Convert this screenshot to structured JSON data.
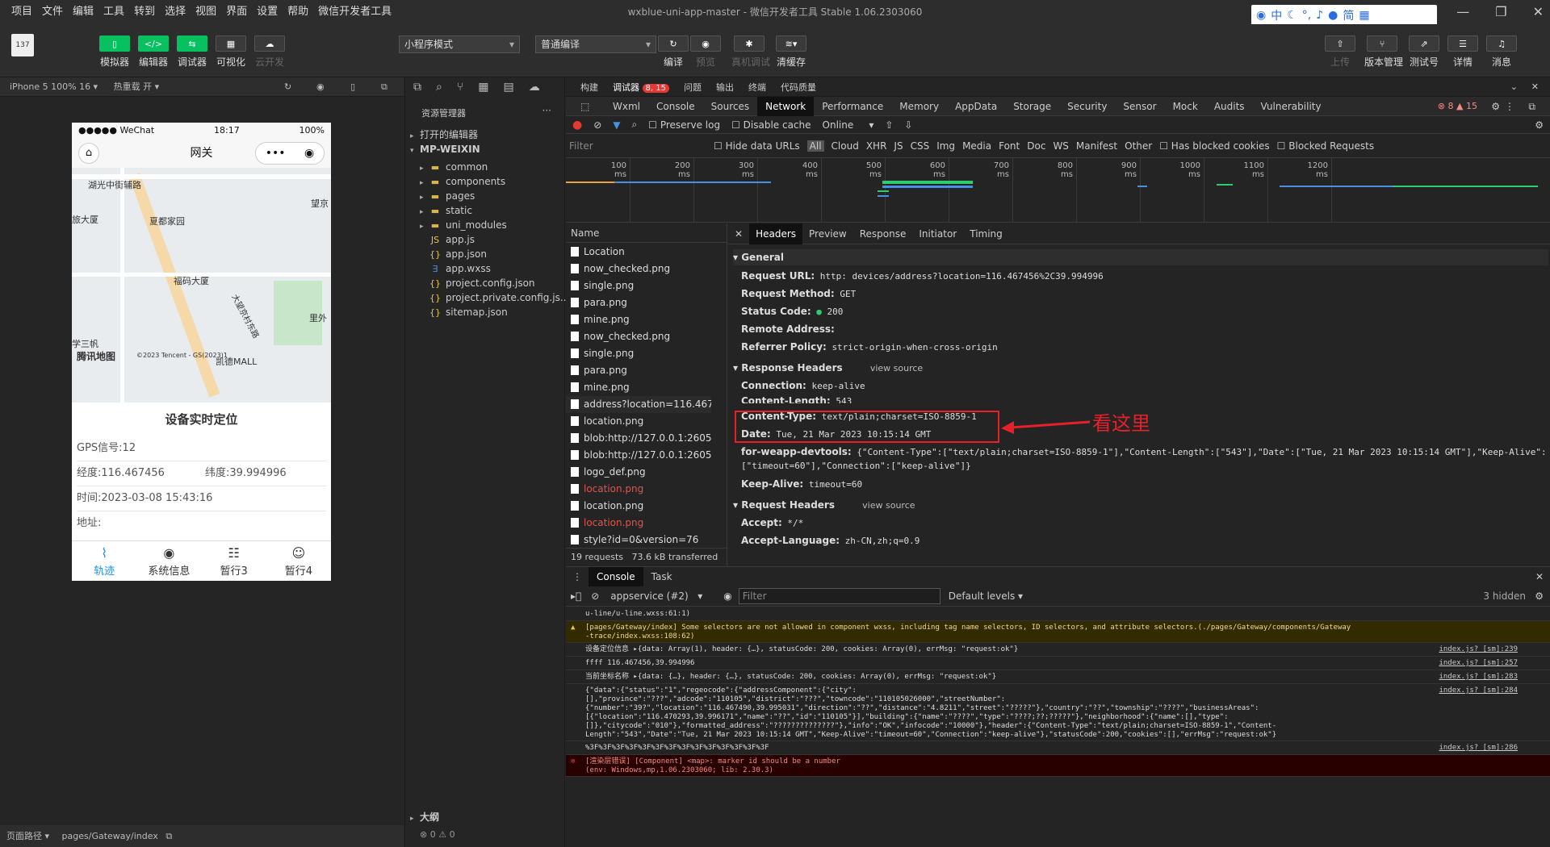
{
  "titlebar": {
    "menu": [
      "项目",
      "文件",
      "编辑",
      "工具",
      "转到",
      "选择",
      "视图",
      "界面",
      "设置",
      "帮助",
      "微信开发者工具"
    ],
    "title": "wxblue-uni-app-master - 微信开发者工具 Stable 1.06.2303060",
    "ime": [
      "中",
      "简"
    ]
  },
  "toolbar": {
    "avatar": "137",
    "buttons": [
      "模拟器",
      "编辑器",
      "调试器",
      "可视化",
      "云开发"
    ],
    "mode_select": "小程序模式",
    "compile_select": "普通编译",
    "mid_buttons": [
      "编译",
      "预览",
      "真机调试",
      "清缓存"
    ],
    "right_buttons": [
      "上传",
      "版本管理",
      "测试号",
      "详情",
      "消息"
    ]
  },
  "sim": {
    "device": "iPhone 5 100% 16 ▾",
    "hotreload": "热重载 开 ▾",
    "footer_path_label": "页面路径 ▾",
    "footer_path": "pages/Gateway/index"
  },
  "phone": {
    "carrier": "●●●●● WeChat",
    "time": "18:17",
    "battery": "100%",
    "nav_title": "网关",
    "map_labels": [
      "湖光中街辅路",
      "望京",
      "旅大厦",
      "夏都家园",
      "福码大厦",
      "里外",
      "学三帆",
      "腾讯地图",
      "©2023 Tencent - GS(2023)1",
      "凯德MALL",
      "大望京村东路"
    ],
    "section_title": "设备实时定位",
    "gps": "GPS信号:12",
    "lng": "经度:116.467456",
    "lat": "纬度:39.994996",
    "time_row": "时间:2023-03-08 15:43:16",
    "addr": "地址:",
    "tabs": [
      "轨迹",
      "系统信息",
      "暂行3",
      "暂行4"
    ]
  },
  "explorer": {
    "title": "资源管理器",
    "open_editors": "打开的编辑器",
    "root": "MP-WEIXIN",
    "items": [
      {
        "name": "common",
        "type": "folder"
      },
      {
        "name": "components",
        "type": "folder"
      },
      {
        "name": "pages",
        "type": "folder"
      },
      {
        "name": "static",
        "type": "folder"
      },
      {
        "name": "uni_modules",
        "type": "folder"
      },
      {
        "name": "app.js",
        "type": "js"
      },
      {
        "name": "app.json",
        "type": "json"
      },
      {
        "name": "app.wxss",
        "type": "wxss"
      },
      {
        "name": "project.config.json",
        "type": "json"
      },
      {
        "name": "project.private.config.js...",
        "type": "json"
      },
      {
        "name": "sitemap.json",
        "type": "json"
      }
    ],
    "outline": "大纲",
    "status": "⊗ 0 ⚠ 0"
  },
  "devtools": {
    "top_tabs": [
      "构建",
      "调试器",
      "问题",
      "输出",
      "终端",
      "代码质量"
    ],
    "badge": "8, 15",
    "panels": [
      "Wxml",
      "Console",
      "Sources",
      "Network",
      "Performance",
      "Memory",
      "AppData",
      "Storage",
      "Security",
      "Sensor",
      "Mock",
      "Audits",
      "Vulnerability"
    ],
    "counts": "⊗ 8 ▲ 15",
    "net_toolbar": {
      "preserve": "Preserve log",
      "disable": "Disable cache",
      "online": "Online"
    },
    "filter": {
      "placeholder": "Filter",
      "hide": "Hide data URLs",
      "types": [
        "All",
        "Cloud",
        "XHR",
        "JS",
        "CSS",
        "Img",
        "Media",
        "Font",
        "Doc",
        "WS",
        "Manifest",
        "Other"
      ],
      "blocked_cookies": "Has blocked cookies",
      "blocked_requests": "Blocked Requests"
    },
    "ticks": [
      "100 ms",
      "200 ms",
      "300 ms",
      "400 ms",
      "500 ms",
      "600 ms",
      "700 ms",
      "800 ms",
      "900 ms",
      "1000 ms",
      "1100 ms",
      "1200 ms"
    ],
    "name_header": "Name",
    "requests": [
      {
        "name": "Location",
        "red": false
      },
      {
        "name": "now_checked.png",
        "red": false
      },
      {
        "name": "single.png",
        "red": false
      },
      {
        "name": "para.png",
        "red": false
      },
      {
        "name": "mine.png",
        "red": false
      },
      {
        "name": "now_checked.png",
        "red": false
      },
      {
        "name": "single.png",
        "red": false
      },
      {
        "name": "para.png",
        "red": false
      },
      {
        "name": "mine.png",
        "red": false
      },
      {
        "name": "address?location=116.467456...",
        "red": false
      },
      {
        "name": "location.png",
        "red": false
      },
      {
        "name": "blob:http://127.0.0.1:26054/a7",
        "red": false
      },
      {
        "name": "blob:http://127.0.0.1:26054/a7",
        "red": false
      },
      {
        "name": "logo_def.png",
        "red": false
      },
      {
        "name": "location.png",
        "red": true
      },
      {
        "name": "location.png",
        "red": false
      },
      {
        "name": "location.png",
        "red": true
      },
      {
        "name": "style?id=0&version=76",
        "red": false
      }
    ],
    "summary": {
      "requests": "19 requests",
      "transferred": "73.6 kB transferred"
    },
    "detail_tabs": [
      "Headers",
      "Preview",
      "Response",
      "Initiator",
      "Timing"
    ],
    "general": {
      "title": "General",
      "url_k": "Request URL:",
      "url_v": "http:                              devices/address?location=116.467456%2C39.994996",
      "method_k": "Request Method:",
      "method_v": "GET",
      "status_k": "Status Code:",
      "status_v": "200",
      "remote_k": "Remote Address:",
      "remote_v": "",
      "referrer_k": "Referrer Policy:",
      "referrer_v": "strict-origin-when-cross-origin"
    },
    "response_headers": {
      "title": "Response Headers",
      "view": "view source",
      "conn_k": "Connection:",
      "conn_v": "keep-alive",
      "len_k": "Content-Length:",
      "len_v": "543",
      "ctype_k": "Content-Type:",
      "ctype_v": "text/plain;charset=ISO-8859-1",
      "date_k": "Date:",
      "date_v": "Tue, 21 Mar 2023 10:15:14 GMT",
      "weapp_k": "for-weapp-devtools:",
      "weapp_v": "{\"Content-Type\":[\"text/plain;charset=ISO-8859-1\"],\"Content-Length\":[\"543\"],\"Date\":[\"Tue, 21 Mar 2023 10:15:14 GMT\"],\"Keep-Alive\":",
      "weapp_v2": "[\"timeout=60\"],\"Connection\":[\"keep-alive\"]}",
      "ka_k": "Keep-Alive:",
      "ka_v": "timeout=60"
    },
    "request_headers": {
      "title": "Request Headers",
      "view": "view source",
      "accept_k": "Accept:",
      "accept_v": "*/*",
      "lang_k": "Accept-Language:",
      "lang_v": "zh-CN,zh;q=0.9"
    },
    "annotation": "看这里",
    "console": {
      "tabs": [
        "Console",
        "Task"
      ],
      "context": "appservice (#2)",
      "filter_placeholder": "Filter",
      "levels": "Default levels ▾",
      "hidden": "3 hidden",
      "lines": [
        {
          "text": "u-line/u-line.wxss:61:1)",
          "src": ""
        },
        {
          "text": "[pages/Gateway/index] Some selectors are not allowed in component wxss, including tag name selectors, ID selectors, and attribute selectors.(./pages/Gateway/components/Gateway\n-trace/index.wxss:108:62)",
          "src": "",
          "kind": "warn"
        },
        {
          "text": "设备定位信息 ▸{data: Array(1), header: {…}, statusCode: 200, cookies: Array(0), errMsg: \"request:ok\"}",
          "src": "index.js? [sm]:239"
        },
        {
          "text": "ffff 116.467456,39.994996",
          "src": "index.js? [sm]:257"
        },
        {
          "text": "当前坐标名称 ▸{data: {…}, header: {…}, statusCode: 200, cookies: Array(0), errMsg: \"request:ok\"}",
          "src": "index.js? [sm]:283"
        },
        {
          "text": "{\"data\":{\"status\":\"1\",\"regeocode\":{\"addressComponent\":{\"city\":\n[],\"province\":\"???\",\"adcode\":\"110105\",\"district\":\"???\",\"towncode\":\"110105026000\",\"streetNumber\":\n{\"number\":\"39?\",\"location\":\"116.467490,39.995031\",\"direction\":\"??\",\"distance\":\"4.8211\",\"street\":\"?????\"},\"country\":\"??\",\"township\":\"????\",\"businessAreas\":\n[{\"location\":\"116.470293,39.996171\",\"name\":\"??\",\"id\":\"110105\"}],\"building\":{\"name\":\"????\",\"type\":\"????;??;?????\"},\"neighborhood\":{\"name\":[],\"type\":\n[]},\"citycode\":\"010\"},\"formatted_address\":\"??????????????\"},\"info\":\"OK\",\"infocode\":\"10000\"},\"header\":{\"Content-Type\":\"text/plain;charset=ISO-8859-1\",\"Content-\nLength\":\"543\",\"Date\":\"Tue, 21 Mar 2023 10:15:14 GMT\",\"Keep-Alive\":\"timeout=60\",\"Connection\":\"keep-alive\"},\"statusCode\":200,\"cookies\":[],\"errMsg\":\"request:ok\"}",
          "src": "index.js? [sm]:284"
        },
        {
          "text": "%3F%3F%3F%3F%3F%3F%3F%3F%3F%3F%3F%3F%3F%3F",
          "src": "index.js? [sm]:286"
        },
        {
          "text": "[渲染层错误] [Component] <map>: marker id should be a number\n(env: Windows,mp,1.06.2303060; lib: 2.30.3)",
          "src": "",
          "kind": "err"
        }
      ]
    }
  }
}
